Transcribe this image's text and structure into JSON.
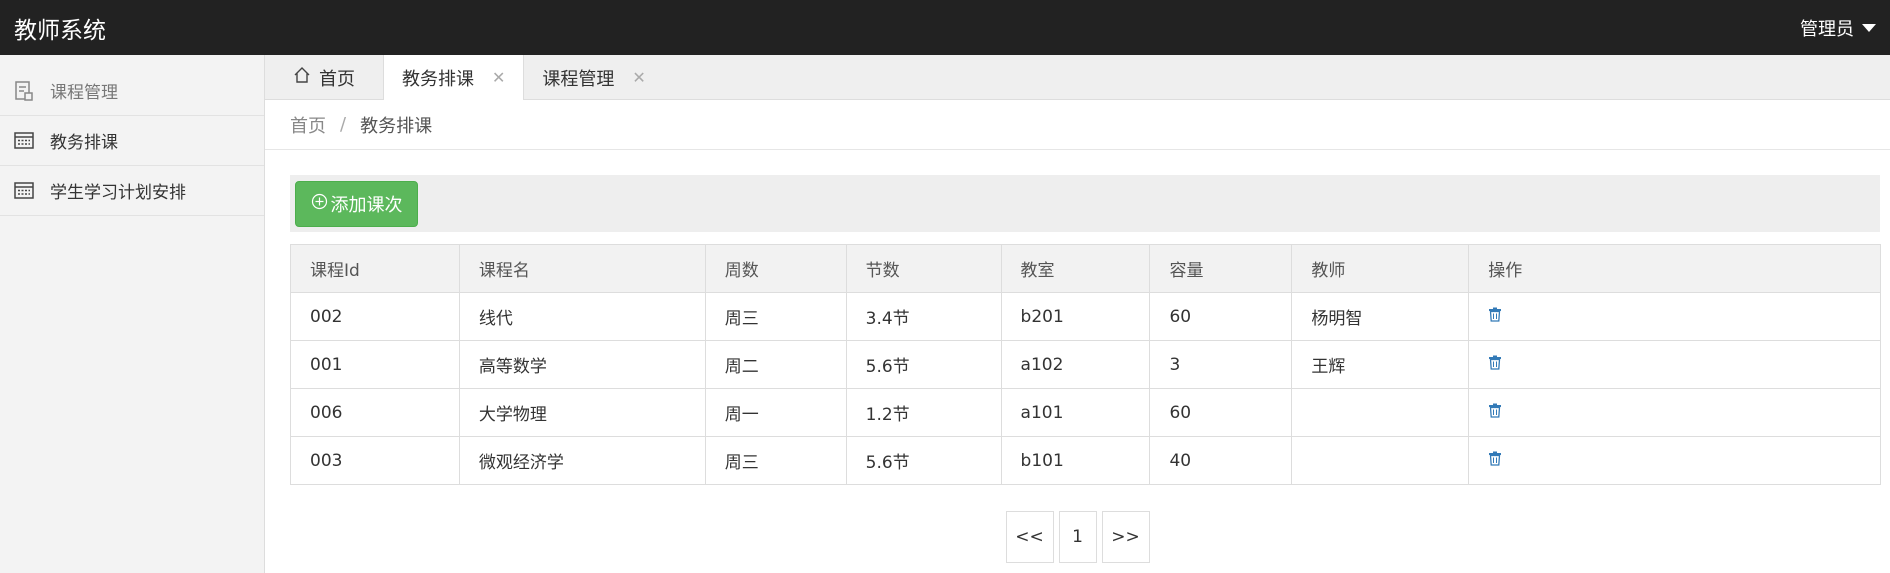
{
  "app": {
    "title": "教师系统",
    "user": "管理员"
  },
  "sidebar": {
    "items": [
      {
        "label": "课程管理",
        "icon": "course-doc-icon"
      },
      {
        "label": "教务排课",
        "icon": "table-list-icon"
      },
      {
        "label": "学生学习计划安排",
        "icon": "table-list-icon"
      }
    ]
  },
  "tabs": [
    {
      "label": "首页",
      "icon": "home-icon"
    },
    {
      "label": "教务排课",
      "closable": true
    },
    {
      "label": "课程管理",
      "closable": true
    }
  ],
  "breadcrumb": {
    "home": "首页",
    "separator": "/",
    "current": "教务排课"
  },
  "toolbar": {
    "add_label": "添加课次"
  },
  "table": {
    "columns": [
      "课程Id",
      "课程名",
      "周数",
      "节数",
      "教室",
      "容量",
      "教师",
      "操作"
    ],
    "rows": [
      [
        "002",
        "线代",
        "周三",
        "3.4节",
        "b201",
        "60",
        "杨明智"
      ],
      [
        "001",
        "高等数学",
        "周二",
        "5.6节",
        "a102",
        "3",
        "王辉"
      ],
      [
        "006",
        "大学物理",
        "周一",
        "1.2节",
        "a101",
        "60",
        ""
      ],
      [
        "003",
        "微观经济学",
        "周三",
        "5.6节",
        "b101",
        "40",
        ""
      ]
    ]
  },
  "pagination": {
    "prev": "<<",
    "page": "1",
    "next": ">>"
  },
  "colors": {
    "topbar": "#222222",
    "accent_green": "#5cb85c",
    "icon_blue": "#337ab7"
  }
}
